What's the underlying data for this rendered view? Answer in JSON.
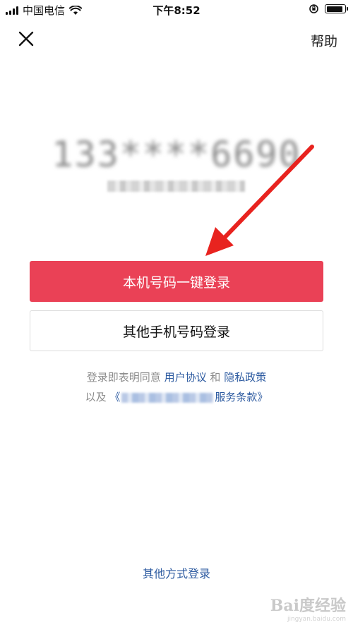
{
  "status_bar": {
    "carrier": "中国电信",
    "time": "下午8:52",
    "battery_level": 0.9
  },
  "nav": {
    "close_icon": "close-icon",
    "help_label": "帮助"
  },
  "account": {
    "masked_phone": "133****6690"
  },
  "buttons": {
    "one_click_login": "本机号码一键登录",
    "other_phone_login": "其他手机号码登录"
  },
  "agreement": {
    "prefix": "登录即表明同意",
    "user_agreement": "用户协议",
    "and": "和",
    "privacy_policy": "隐私政策",
    "also": "以及",
    "open_bracket": "《",
    "service_terms_tail": "服务条款》"
  },
  "footer": {
    "other_methods": "其他方式登录"
  },
  "watermark": {
    "logo": "Bai度经验",
    "url": "jingyan.baidu.com"
  },
  "colors": {
    "primary": "#ea4156",
    "link": "#2c5aa0",
    "annotation_arrow": "#e8231f"
  }
}
